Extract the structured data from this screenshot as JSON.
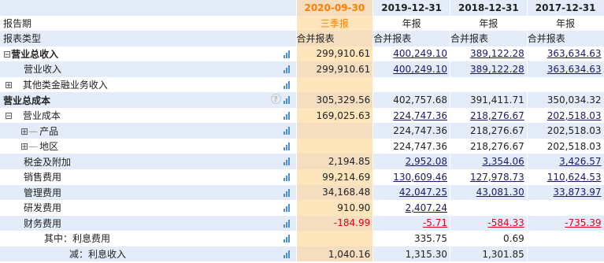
{
  "header": {
    "dates": [
      "2020-09-30",
      "2019-12-31",
      "2018-12-31",
      "2017-12-31"
    ],
    "period_label": "报告期",
    "periods": [
      "三季报",
      "年报",
      "年报",
      "年报"
    ],
    "type_label": "报表类型",
    "types": [
      "合并报表",
      "合并报表",
      "合并报表",
      "合并报表"
    ]
  },
  "rows": [
    {
      "label": "营业总收入",
      "toggle": "⊟",
      "values": [
        "299,910.61",
        "400,249.10",
        "389,122.28",
        "363,634.63"
      ]
    },
    {
      "label": "营业收入",
      "values": [
        "299,910.61",
        "400,249.10",
        "389,122.28",
        "363,634.63"
      ]
    },
    {
      "label": "其他类金融业务收入",
      "toggle": "⊞",
      "values": [
        "",
        "",
        "",
        ""
      ]
    },
    {
      "label": "营业总成本",
      "values": [
        "305,329.56",
        "402,757.68",
        "391,411.71",
        "350,034.32"
      ]
    },
    {
      "label": "营业成本",
      "toggle": "⊟",
      "values": [
        "169,025.63",
        "224,747.36",
        "218,276.67",
        "202,518.03"
      ]
    },
    {
      "label": "产品",
      "toggle": "⊞",
      "values": [
        "",
        "224,747.36",
        "218,276.67",
        "202,518.03"
      ]
    },
    {
      "label": "地区",
      "toggle": "⊞",
      "values": [
        "",
        "224,747.36",
        "218,276.67",
        "202,518.03"
      ]
    },
    {
      "label": "税金及附加",
      "values": [
        "2,194.85",
        "2,952.08",
        "3,354.06",
        "3,426.57"
      ]
    },
    {
      "label": "销售费用",
      "values": [
        "99,214.69",
        "130,609.46",
        "127,978.73",
        "110,624.53"
      ]
    },
    {
      "label": "管理费用",
      "values": [
        "34,168.48",
        "42,047.25",
        "43,081.30",
        "33,873.97"
      ]
    },
    {
      "label": "研发费用",
      "values": [
        "910.90",
        "2,407.24",
        "",
        ""
      ]
    },
    {
      "label": "财务费用",
      "values": [
        "-184.99",
        "-5.71",
        "-584.33",
        "-735.39"
      ]
    },
    {
      "label": "其中：利息费用",
      "values": [
        "",
        "335.75",
        "0.69",
        ""
      ]
    },
    {
      "label": "减：利息收入",
      "values": [
        "1,040.16",
        "1,315.30",
        "1,301.85",
        ""
      ]
    }
  ],
  "help_icon": "question-circle-icon",
  "chart_icon": "bar-chart-icon",
  "colors": {
    "highlight_column": "#ffe5bc",
    "row_band": "#e3ecf8",
    "accent": "#ff7f00",
    "negative": "#e60012",
    "chart_icon": "#4d8fd6"
  }
}
